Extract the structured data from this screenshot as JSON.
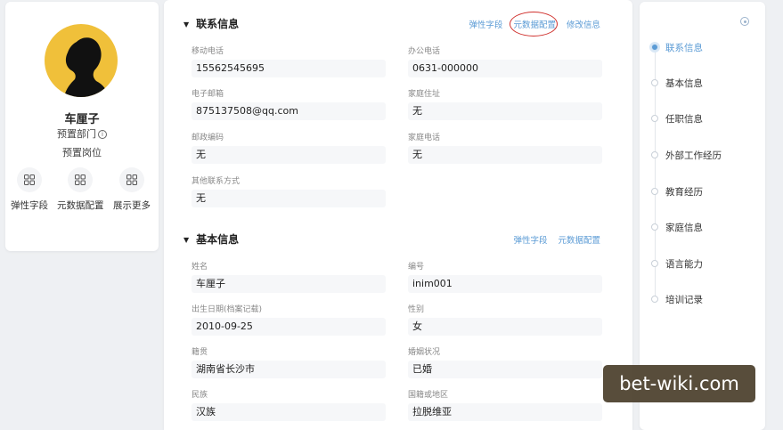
{
  "profile": {
    "name": "车厘子",
    "department": "预置部门",
    "post": "预置岗位",
    "actions": [
      {
        "label": "弹性字段",
        "icon": "grid-icon"
      },
      {
        "label": "元数据配置",
        "icon": "grid-icon"
      },
      {
        "label": "展示更多",
        "icon": "grid-icon"
      }
    ]
  },
  "contact": {
    "title": "联系信息",
    "links": [
      "弹性字段",
      "元数据配置",
      "修改信息"
    ],
    "fields": [
      {
        "label": "移动电话",
        "value": "15562545695"
      },
      {
        "label": "办公电话",
        "value": "0631-000000"
      },
      {
        "label": "电子邮箱",
        "value": "875137508@qq.com"
      },
      {
        "label": "家庭住址",
        "value": "无"
      },
      {
        "label": "邮政编码",
        "value": "无"
      },
      {
        "label": "家庭电话",
        "value": "无"
      },
      {
        "label": "其他联系方式",
        "value": "无"
      }
    ]
  },
  "basic": {
    "title": "基本信息",
    "links": [
      "弹性字段",
      "元数据配置"
    ],
    "fields": [
      {
        "label": "姓名",
        "value": "车厘子"
      },
      {
        "label": "编号",
        "value": "inim001"
      },
      {
        "label": "出生日期(档案记载)",
        "value": "2010-09-25"
      },
      {
        "label": "性别",
        "value": "女"
      },
      {
        "label": "籍贯",
        "value": "湖南省长沙市"
      },
      {
        "label": "婚姻状况",
        "value": "已婚"
      },
      {
        "label": "民族",
        "value": "汉族"
      },
      {
        "label": "国籍或地区",
        "value": "拉脱维亚"
      }
    ]
  },
  "nav": {
    "items": [
      "联系信息",
      "基本信息",
      "任职信息",
      "外部工作经历",
      "教育经历",
      "家庭信息",
      "语言能力",
      "培训记录"
    ],
    "active_index": 0
  },
  "watermark": "bet-wiki.com",
  "colors": {
    "accent": "#5b9bd5",
    "annotation_circle": "#d0312d",
    "avatar_bg": "#f0c03a"
  }
}
